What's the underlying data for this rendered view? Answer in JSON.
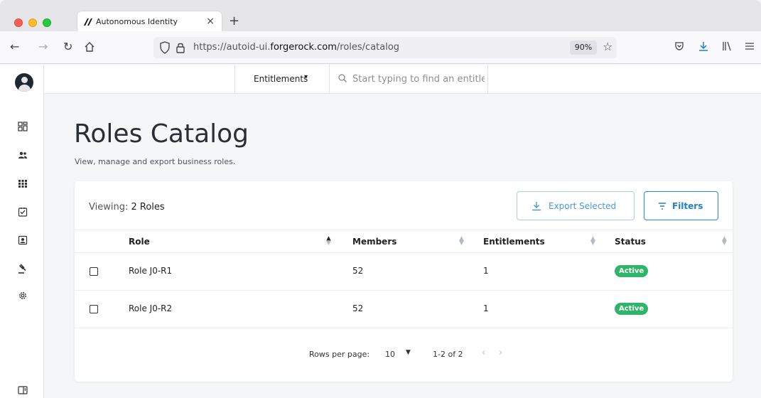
{
  "browser": {
    "tab_title": "Autonomous Identity",
    "url_prefix": "https://autoid-ui.",
    "url_host": "forgerock.com",
    "url_path": "/roles/catalog",
    "zoom": "90%"
  },
  "topbar": {
    "dropdown_label": "Entitlements",
    "search_placeholder": "Start typing to find an entitlement"
  },
  "page": {
    "title": "Roles Catalog",
    "subtitle": "View, manage and export business roles."
  },
  "card": {
    "viewing_label": "Viewing:",
    "viewing_count": "2 Roles",
    "export_label": "Export Selected",
    "filters_label": "Filters"
  },
  "table": {
    "columns": [
      "Role",
      "Members",
      "Entitlements",
      "Status"
    ],
    "rows": [
      {
        "role": "Role J0-R1",
        "members": "52",
        "entitlements": "1",
        "status": "Active"
      },
      {
        "role": "Role J0-R2",
        "members": "52",
        "entitlements": "1",
        "status": "Active"
      }
    ]
  },
  "pagination": {
    "rows_per_page_label": "Rows per page:",
    "rows_per_page": "10",
    "range": "1-2 of 2"
  },
  "colors": {
    "accent": "#1f7fd0",
    "status_active": "#2fb56a"
  }
}
